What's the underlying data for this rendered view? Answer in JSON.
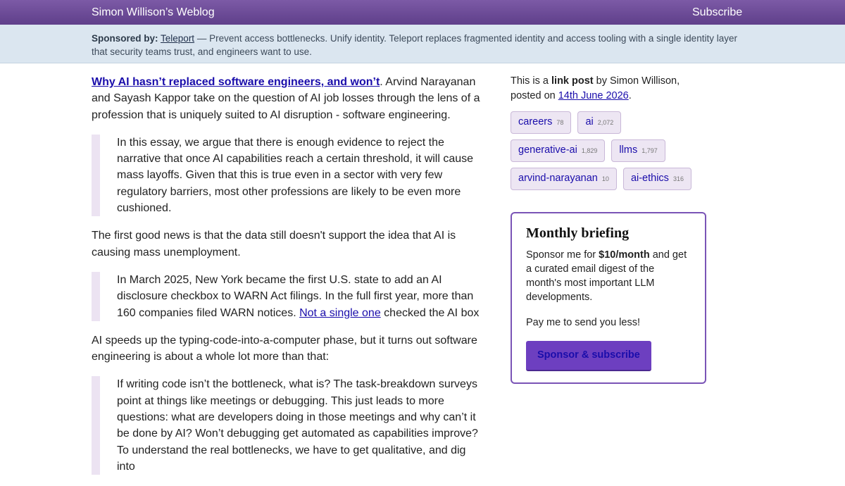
{
  "header": {
    "site_title": "Simon Willison’s Weblog",
    "subscribe": "Subscribe"
  },
  "sponsor_banner": {
    "label": "Sponsored by:",
    "link": "Teleport",
    "text": " — Prevent access bottlenecks. Unify identity. Teleport replaces fragmented identity and access tooling with a single identity layer that security teams trust, and engineers want to use."
  },
  "article": {
    "headline": "Why AI hasn’t replaced software engineers, and won’t",
    "intro_rest": ". Arvind Narayanan and Sayash Kappor take on the question of AI job losses through the lens of a profession that is uniquely suited to AI disruption - software engineering.",
    "quote1": "In this essay, we argue that there is enough evidence to reject the narrative that once AI capabilities reach a certain threshold, it will cause mass layoffs. Given that this is true even in a sector with very few regulatory barriers, most other professions are likely to be even more cushioned.",
    "para2": "The first good news is that the data still doesn't support the idea that AI is causing mass unemployment.",
    "quote2_before": "In March 2025, New York became the first U.S. state to add an AI disclosure checkbox to WARN Act filings. In the full first year, more than 160 companies filed WARN notices. ",
    "quote2_link": "Not a single one",
    "quote2_after": " checked the AI box",
    "para3": "AI speeds up the typing-code-into-a-computer phase, but it turns out software engineering is about a whole lot more than that:",
    "quote3": "If writing code isn’t the bottleneck, what is? The task-breakdown surveys point at things like meetings or debugging. This just leads to more questions: what are developers doing in those meetings and why can’t it be done by AI? Won’t debugging get automated as capabilities improve? To understand the real bottlenecks, we have to get qualitative, and dig into"
  },
  "sidebar": {
    "meta_prefix": "This is a ",
    "meta_bold": "link post",
    "meta_mid": " by Simon Willison, posted on ",
    "date": "14th June 2026",
    "meta_end": ".",
    "tags": [
      {
        "name": "careers",
        "count": "78"
      },
      {
        "name": "ai",
        "count": "2,072"
      },
      {
        "name": "generative-ai",
        "count": "1,829"
      },
      {
        "name": "llms",
        "count": "1,797"
      },
      {
        "name": "arvind-narayanan",
        "count": "10"
      },
      {
        "name": "ai-ethics",
        "count": "316"
      }
    ],
    "briefing": {
      "title": "Monthly briefing",
      "text_before": "Sponsor me for ",
      "text_bold": "$10/month",
      "text_after": " and get a curated email digest of the month's most important LLM developments.",
      "text2": "Pay me to send you less!",
      "button": "Sponsor & subscribe"
    }
  },
  "colors": {
    "header": "#6b4b96",
    "accent": "#6d3fc0",
    "sponsor_bg": "#dbe6f0"
  }
}
